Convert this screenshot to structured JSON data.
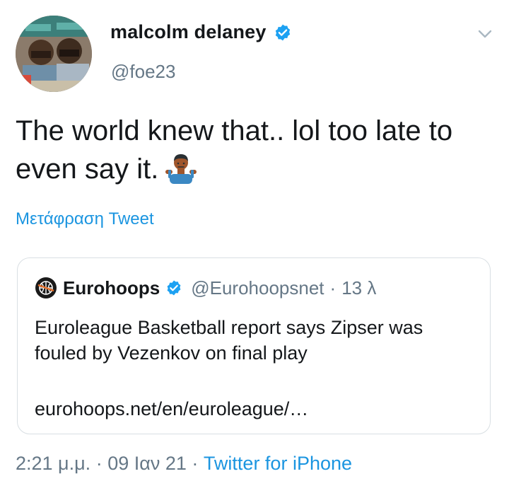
{
  "author": {
    "display_name": "malcolm delaney",
    "handle": "@foe23",
    "verified": true
  },
  "tweet": {
    "text": "The world knew that.. lol too late to even say it.",
    "emoji": "person-shrugging"
  },
  "translate_label": "Μετάφραση Tweet",
  "quoted_tweet": {
    "display_name": "Eurohoops",
    "handle": "@Eurohoopsnet",
    "separator": "·",
    "time": "13 λ",
    "verified": true,
    "text": "Euroleague Basketball report says Zipser was fouled by Vezenkov on final play",
    "link": "eurohoops.net/en/euroleague/…"
  },
  "footer": {
    "time": "2:21 μ.μ.",
    "sep1": "·",
    "date": "09 Ιαν 21",
    "sep2": "·",
    "source": "Twitter for iPhone"
  },
  "colors": {
    "link_blue": "#1b95e0",
    "verified_blue": "#1da1f2",
    "secondary_gray": "#657786",
    "card_border": "#d9dfe3"
  }
}
